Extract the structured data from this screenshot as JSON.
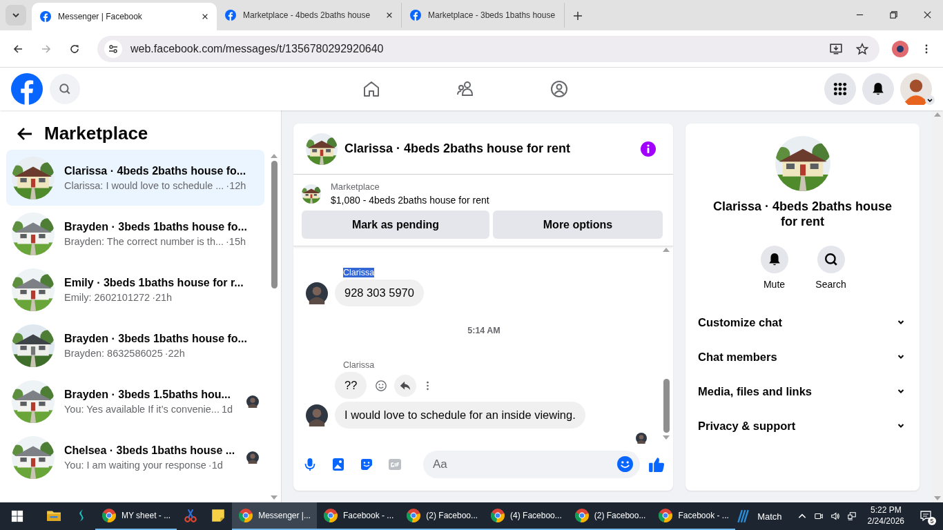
{
  "browser": {
    "tabs": [
      {
        "title": "Messenger | Facebook",
        "selected": true
      },
      {
        "title": "Marketplace - 4beds 2baths house",
        "selected": false
      },
      {
        "title": "Marketplace - 3beds 1baths house",
        "selected": false
      }
    ],
    "url": "web.facebook.com/messages/t/1356780292920640"
  },
  "sidebar": {
    "title": "Marketplace",
    "conversations": [
      {
        "title": "Clarissa · 4beds 2baths house fo...",
        "preview": "Clarissa: I would love to schedule ...",
        "time": "·12h",
        "selected": true,
        "seen": false
      },
      {
        "title": "Brayden · 3beds 1baths house fo...",
        "preview": "Brayden: The correct number is th...",
        "time": "·15h",
        "selected": false,
        "seen": false
      },
      {
        "title": "Emily · 3beds 1baths house for r...",
        "preview": "Emily: 2602101272",
        "time": "·21h",
        "selected": false,
        "seen": false
      },
      {
        "title": "Brayden · 3beds 1baths house fo...",
        "preview": "Brayden: 8632586025",
        "time": "·22h",
        "selected": false,
        "seen": false
      },
      {
        "title": "Brayden · 3beds 1.5baths hou...",
        "preview": "You: Yes available If it’s convenie...",
        "time": "1d",
        "selected": false,
        "seen": true
      },
      {
        "title": "Chelsea · 3beds 1baths house ...",
        "preview": "You: I am waiting your response",
        "time": "·1d",
        "selected": false,
        "seen": true
      }
    ]
  },
  "chat": {
    "title": "Clarissa · 4beds 2baths house for rent",
    "listing": {
      "label": "Marketplace",
      "text": "$1,080 - 4beds 2baths house for rent"
    },
    "buttons": [
      "Mark as pending",
      "More options"
    ],
    "messages": [
      {
        "kind": "sender",
        "text": "Clarissa",
        "selected": true
      },
      {
        "kind": "message",
        "text": "928 303 5970",
        "avatar": true,
        "actions": false
      },
      {
        "kind": "timestamp",
        "text": "5:14 AM"
      },
      {
        "kind": "sender",
        "text": "Clarissa",
        "selected": false
      },
      {
        "kind": "message",
        "text": "??",
        "avatar": false,
        "actions": true
      },
      {
        "kind": "message",
        "text": "I would love to schedule for an inside viewing.",
        "avatar": true,
        "actions": false
      }
    ],
    "composer": {
      "placeholder": "Aa"
    }
  },
  "details": {
    "title": "Clarissa · 4beds 2baths house for rent",
    "actions": [
      {
        "kind": "mute",
        "label": "Mute"
      },
      {
        "kind": "search",
        "label": "Search"
      }
    ],
    "sections": [
      "Customize chat",
      "Chat members",
      "Media, files and links",
      "Privacy & support"
    ]
  },
  "taskbar": {
    "items": [
      {
        "kind": "explorer",
        "active": false
      },
      {
        "kind": "surfshark",
        "active": false
      },
      {
        "kind": "chrome",
        "label": "MY sheet - ...",
        "active": false
      },
      {
        "kind": "snip",
        "active": false
      },
      {
        "kind": "notes",
        "active": false
      },
      {
        "kind": "chrome",
        "label": "Messenger |...",
        "active": true
      },
      {
        "kind": "chrome",
        "label": "Facebook - ...",
        "active": false
      },
      {
        "kind": "chrome",
        "label": "(2) Faceboo...",
        "active": false
      },
      {
        "kind": "chrome",
        "label": "(4) Faceboo...",
        "active": false
      },
      {
        "kind": "chrome",
        "label": "(2) Faceboo...",
        "active": false
      },
      {
        "kind": "chrome",
        "label": "Facebook - ...",
        "active": false
      }
    ],
    "widget": "Match",
    "time": "5:22 PM",
    "date": "2/24/2026",
    "notifications": "5"
  }
}
